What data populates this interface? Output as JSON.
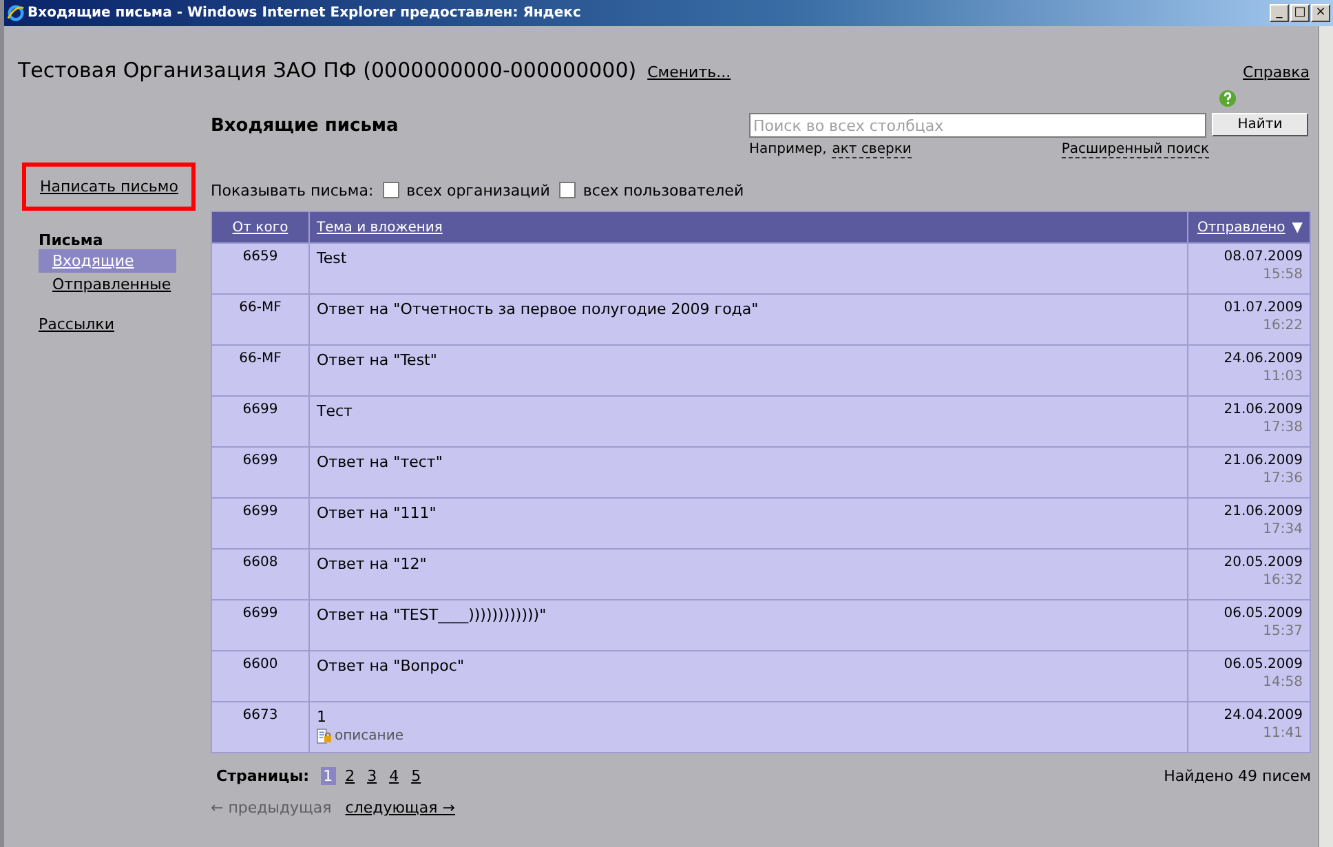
{
  "window": {
    "title": "Входящие письма - Windows Internet Explorer предоставлен: Яндекс",
    "controls": [
      "_",
      "□",
      "×"
    ]
  },
  "header": {
    "organization": "Тестовая Организация ЗАО ПФ (0000000000-000000000)",
    "change_link": "Сменить...",
    "help_link": "Справка"
  },
  "sidebar": {
    "compose": {
      "label": "Написать письмо",
      "highlighted": true
    },
    "section": "Письма",
    "items": [
      {
        "label": "Входящие",
        "selected": true
      },
      {
        "label": "Отправленные",
        "selected": false
      }
    ],
    "mailings": "Рассылки"
  },
  "page_title": "Входящие письма",
  "search": {
    "placeholder": "Поиск во всех столбцах",
    "button": "Найти",
    "example_prefix": "Например,",
    "example_link": "акт сверки",
    "advanced_link": "Расширенный поиск"
  },
  "filter": {
    "label": "Показывать письма:",
    "options": [
      {
        "label": "всех организаций",
        "checked": false
      },
      {
        "label": "всех пользователей",
        "checked": false
      }
    ]
  },
  "table": {
    "columns": [
      {
        "label": "От кого",
        "sorted": false
      },
      {
        "label": "Тема и вложения",
        "sorted": false
      },
      {
        "label": "Отправлено",
        "sorted": true
      }
    ],
    "sort_mark": "▼",
    "rows": [
      {
        "from": "6659",
        "subject": "Test",
        "date": "08.07.2009",
        "time": "15:58"
      },
      {
        "from": "66-MF",
        "subject": "Ответ на \"Отчетность за первое полугодие 2009 года\"",
        "date": "01.07.2009",
        "time": "16:22"
      },
      {
        "from": "66-MF",
        "subject": "Ответ на \"Test\"",
        "date": "24.06.2009",
        "time": "11:03"
      },
      {
        "from": "6699",
        "subject": "Тест",
        "date": "21.06.2009",
        "time": "17:38"
      },
      {
        "from": "6699",
        "subject": "Ответ на \"тест\"",
        "date": "21.06.2009",
        "time": "17:36"
      },
      {
        "from": "6699",
        "subject": "Ответ на \"111\"",
        "date": "21.06.2009",
        "time": "17:34"
      },
      {
        "from": "6608",
        "subject": "Ответ на \"12\"",
        "date": "20.05.2009",
        "time": "16:32"
      },
      {
        "from": "6699",
        "subject": "Ответ на \"TEST____))))))))))))\"",
        "date": "06.05.2009",
        "time": "15:37"
      },
      {
        "from": "6600",
        "subject": "Ответ на \"Вопрос\"",
        "date": "06.05.2009",
        "time": "14:58"
      },
      {
        "from": "6673",
        "subject": "1",
        "attachment": "описание",
        "date": "24.04.2009",
        "time": "11:41"
      }
    ]
  },
  "pagination": {
    "label": "Страницы:",
    "pages": [
      {
        "label": "1",
        "selected": true
      },
      {
        "label": "2",
        "selected": false
      },
      {
        "label": "3",
        "selected": false
      },
      {
        "label": "4",
        "selected": false
      },
      {
        "label": "5",
        "selected": false
      }
    ],
    "prev": {
      "label": "← предыдущая",
      "disabled": true
    },
    "next": {
      "label": "следующая →",
      "disabled": false
    },
    "found": "Найдено 49 писем"
  }
}
